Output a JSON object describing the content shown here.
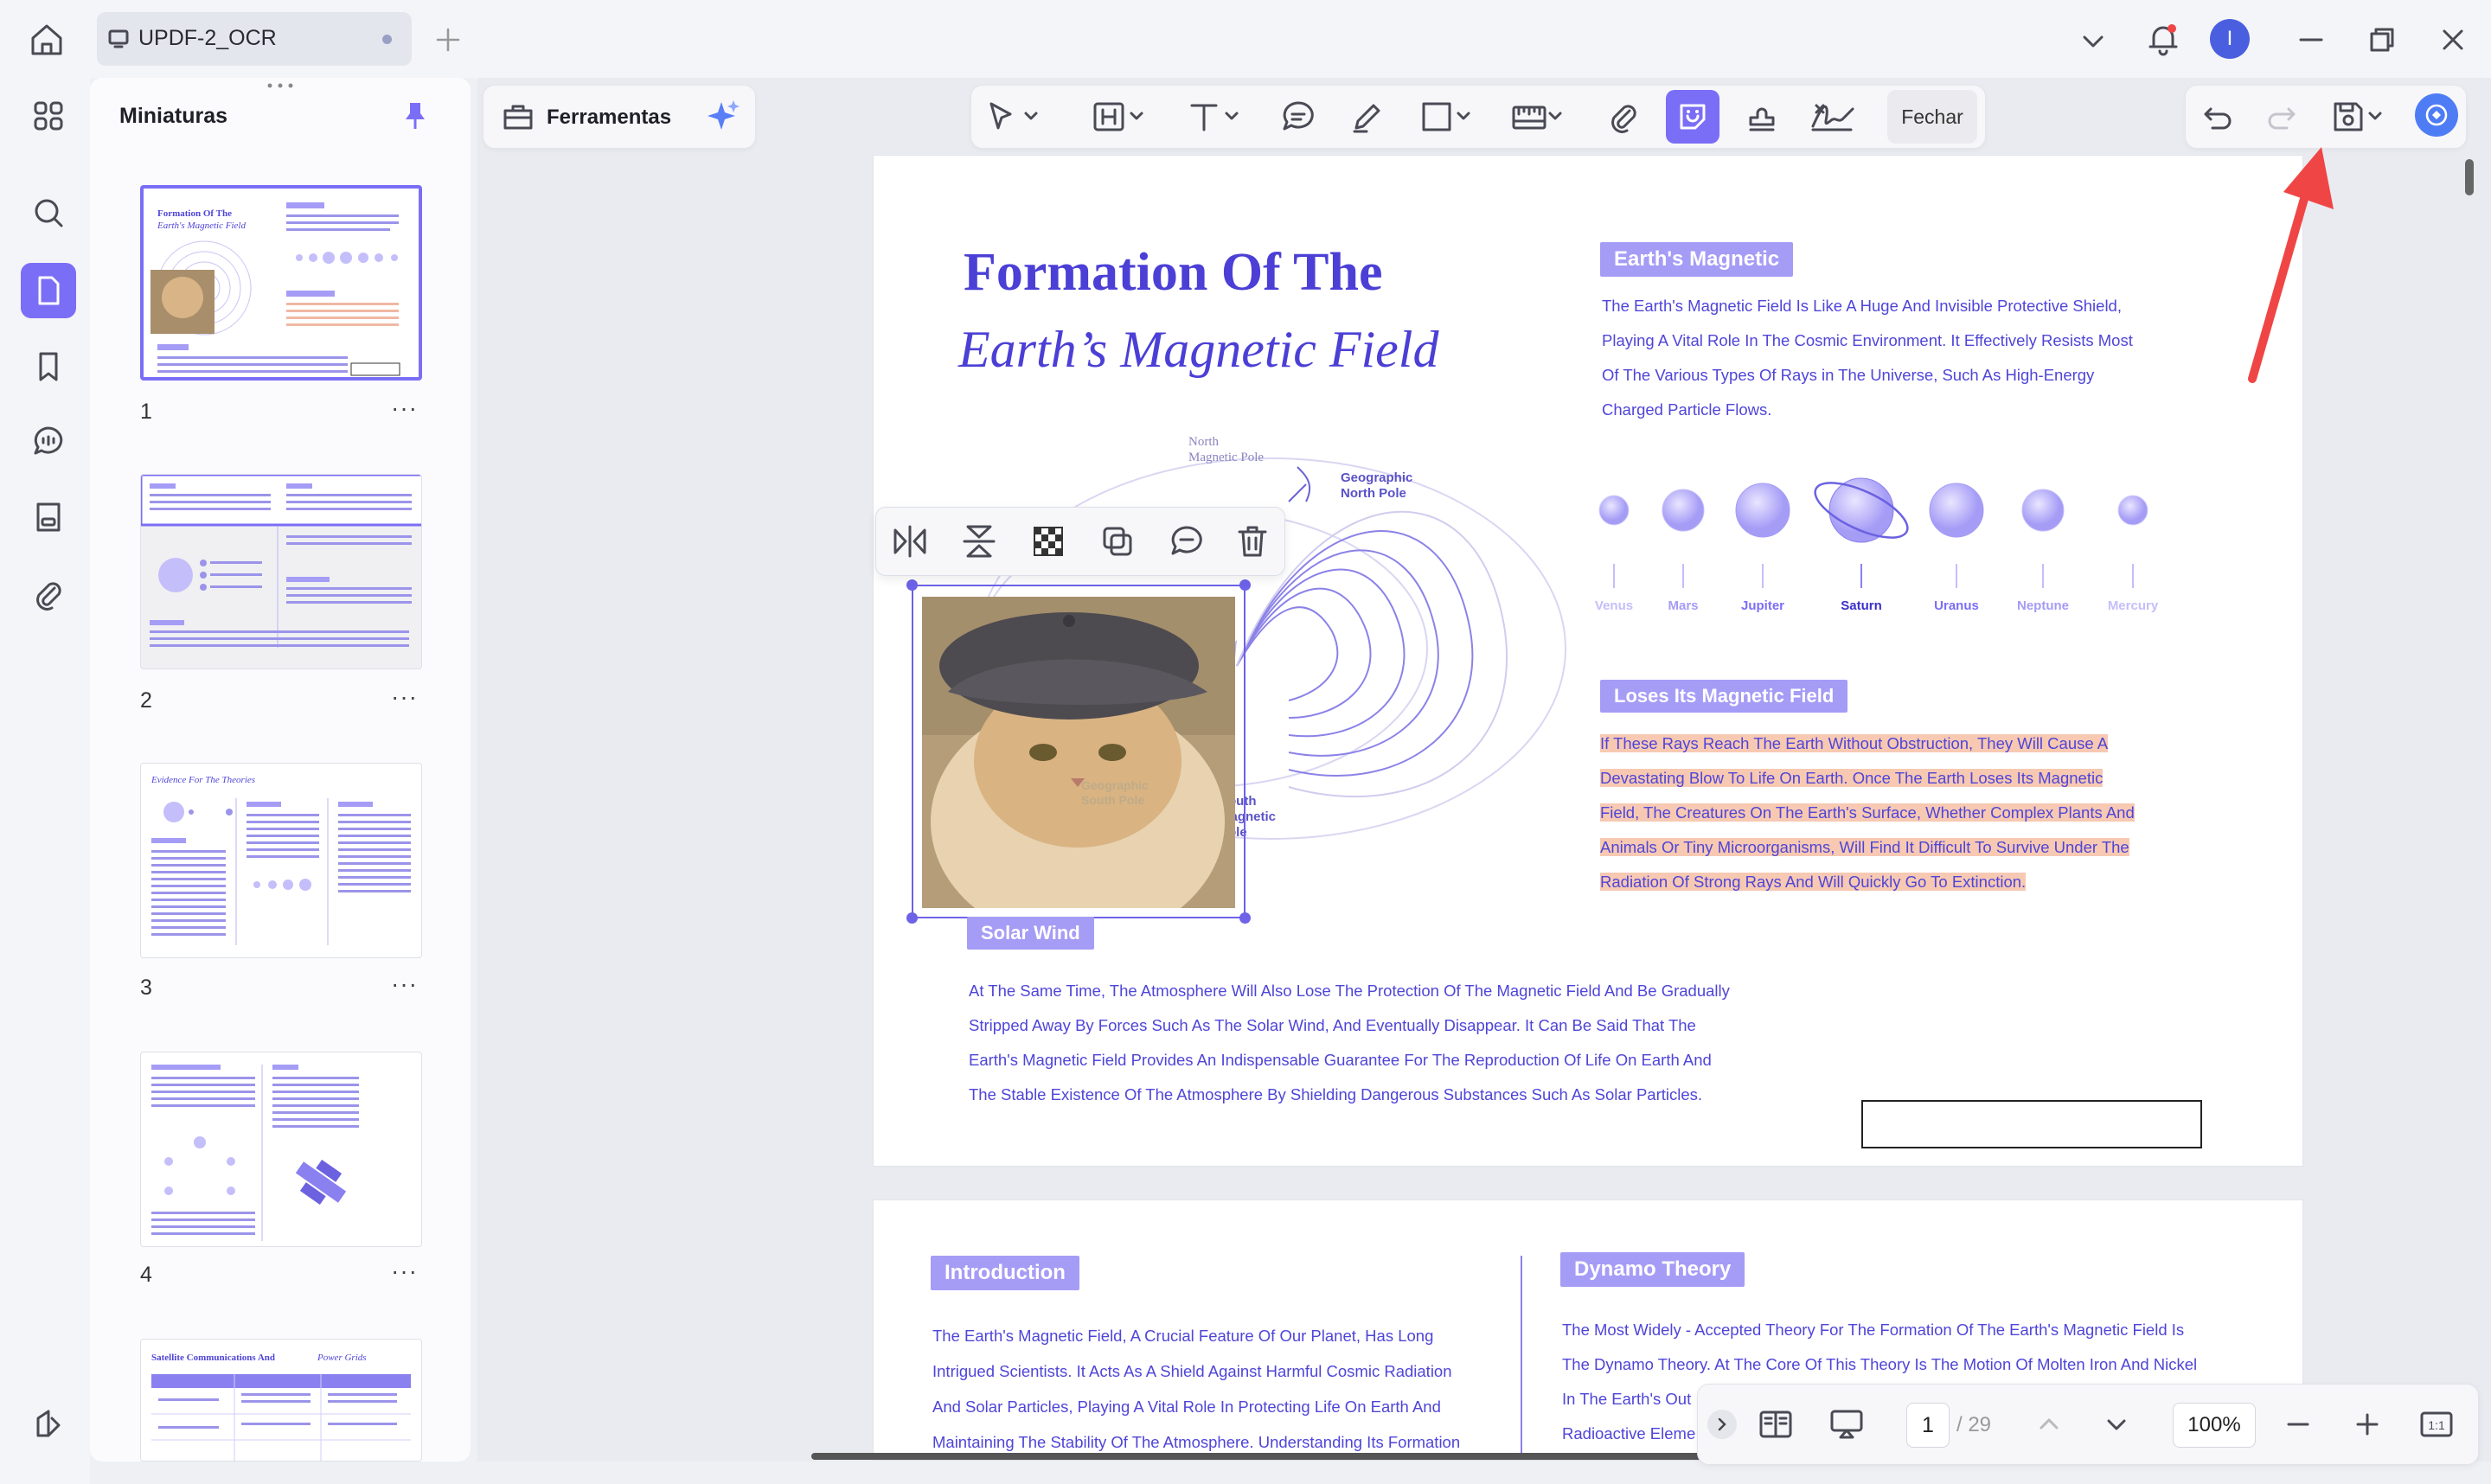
{
  "window": {
    "tab_title": "UPDF-2_OCR",
    "avatar_initial": "I"
  },
  "sidebar": {
    "panel_title": "Miniaturas",
    "thumbnails": [
      {
        "page": "1",
        "more": "···"
      },
      {
        "page": "2",
        "more": "···"
      },
      {
        "page": "3",
        "more": "···"
      },
      {
        "page": "4",
        "more": "···"
      }
    ]
  },
  "toolbar": {
    "tools_label": "Ferramentas",
    "close_label": "Fechar"
  },
  "page1": {
    "title_line1": "Formation Of The",
    "title_line2": "Earth’s Magnetic Field",
    "earth_tag": "Earth's Magnetic",
    "earth_text": [
      "The Earth's Magnetic Field Is Like A Huge And Invisible Protective Shield,",
      "Playing A Vital Role In The Cosmic Environment. It Effectively Resists Most",
      "Of The Various Types Of Rays in The Universe, Such As High-Energy",
      "Charged Particle Flows."
    ],
    "planets": [
      "Venus",
      "Mars",
      "Jupiter",
      "Saturn",
      "Uranus",
      "Neptune",
      "Mercury"
    ],
    "loses_tag": "Loses Its Magnetic Field",
    "loses_text": [
      "If These Rays Reach The Earth Without Obstruction, They Will Cause A",
      "Devastating Blow To Life On Earth. Once The Earth Loses Its Magnetic",
      "Field, The Creatures On The Earth's Surface, Whether Complex Plants And",
      "Animals Or Tiny Microorganisms, Will Find It Difficult To Survive Under The",
      "Radiation Of Strong Rays And Will Quickly Go To Extinction."
    ],
    "diagram_labels": {
      "north_magnetic": "North\nMagnetic Pole",
      "geo_north_1": "Geographic",
      "geo_north_2": "North Pole",
      "south_geo_1": "Geographic",
      "south_geo_2": "South Pole",
      "south_mag_1": "South",
      "south_mag_2": "Magnetic",
      "south_mag_3": "Pole"
    },
    "solar_tag": "Solar Wind",
    "solar_text": [
      "At The Same Time, The Atmosphere Will Also Lose The Protection Of The Magnetic Field And Be Gradually",
      "Stripped Away By Forces Such As The Solar Wind, And Eventually Disappear. It Can Be Said That The",
      "Earth's Magnetic Field Provides An Indispensable Guarantee For The Reproduction Of Life On Earth And",
      "The Stable Existence Of The Atmosphere By Shielding Dangerous Substances Such As Solar Particles."
    ]
  },
  "page2": {
    "intro_tag": "Introduction",
    "intro_text": [
      "The Earth's Magnetic Field, A Crucial Feature Of Our Planet, Has Long",
      "Intrigued Scientists. It Acts As A Shield Against Harmful Cosmic Radiation",
      "And Solar Particles, Playing A Vital Role In Protecting Life On Earth And",
      "Maintaining The Stability Of The Atmosphere. Understanding Its Formation"
    ],
    "dynamo_tag": "Dynamo Theory",
    "dynamo_text": [
      "The Most Widely - Accepted Theory For The Formation Of The Earth's Magnetic Field Is",
      "The Dynamo Theory. At The Core Of This Theory Is The Motion Of Molten Iron And Nickel",
      "In The Earth's Out",
      "Radioactive Eleme"
    ]
  },
  "bottom_nav": {
    "current_page": "1",
    "total_pages": "/ 29",
    "zoom": "100%"
  },
  "colors": {
    "accent": "#7b6ef6",
    "text_purple": "#4f45d8",
    "highlight": "#f7c9b3",
    "annotation_arrow": "#f04545"
  }
}
